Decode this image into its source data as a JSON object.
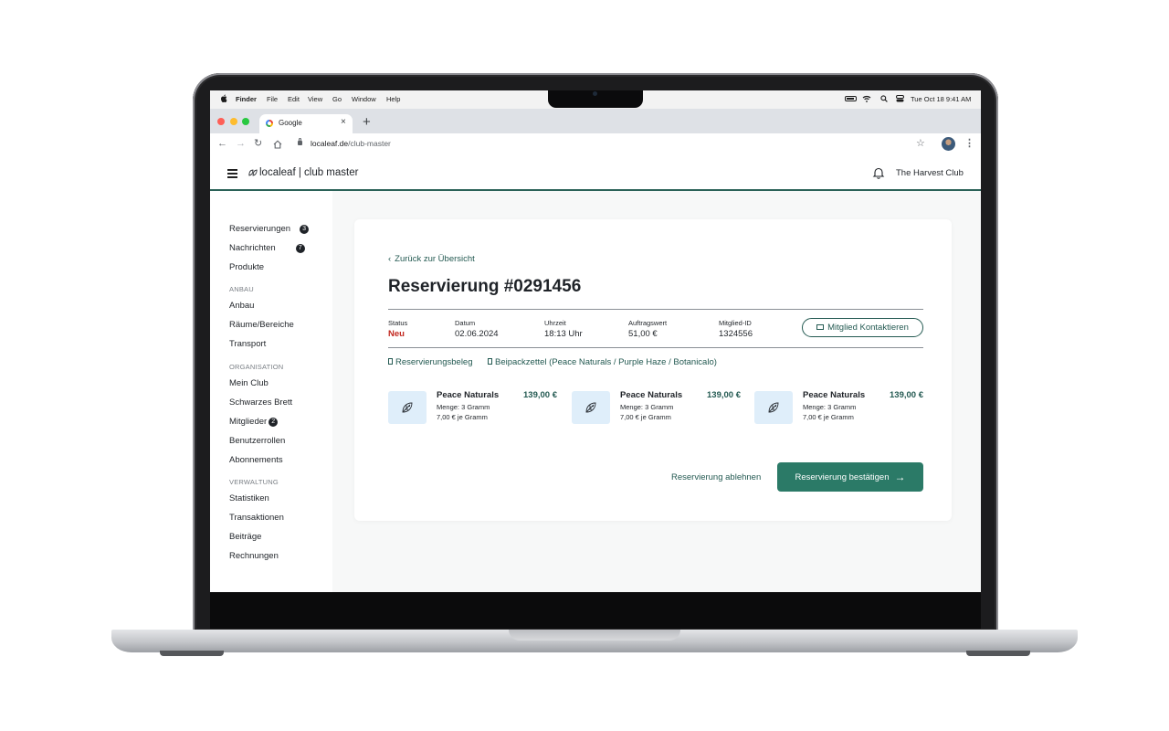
{
  "menubar": {
    "app": "Finder",
    "items": [
      "File",
      "Edit",
      "View",
      "Go",
      "Window",
      "Help"
    ],
    "clock": "Tue Oct 18  9:41 AM"
  },
  "browser": {
    "tab_title": "Google",
    "tab_close": "×",
    "new_tab": "+",
    "url_host": "localeaf.de",
    "url_path": "/club-master"
  },
  "header": {
    "brand": "localeaf | club master",
    "club_name": "The Harvest Club"
  },
  "sidebar": {
    "reservierungen": "Reservierungen",
    "reservierungen_count": "3",
    "nachrichten": "Nachrichten",
    "nachrichten_count": "7",
    "produkte": "Produkte",
    "section_anbau": "ANBAU",
    "anbau": "Anbau",
    "raeume": "Räume/Bereiche",
    "transport": "Transport",
    "section_organisation": "ORGANISATION",
    "mein_club": "Mein Club",
    "schwarzes_brett": "Schwarzes Brett",
    "mitglieder": "Mitglieder",
    "mitglieder_count": "2",
    "benutzerrollen": "Benutzerrollen",
    "abonnements": "Abonnements",
    "section_verwaltung": "VERWALTUNG",
    "statistiken": "Statistiken",
    "transaktionen": "Transaktionen",
    "beitraege": "Beiträge",
    "rechnungen": "Rechnungen"
  },
  "reservation": {
    "back": "Zurück zur Übersicht",
    "title": "Reservierung #0291456",
    "status_label": "Status",
    "status_value": "Neu",
    "date_label": "Datum",
    "date_value": "02.06.2024",
    "time_label": "Uhrzeit",
    "time_value": "18:13 Uhr",
    "amount_label": "Auftragswert",
    "amount_value": "51,00 €",
    "member_label": "Mitglied-ID",
    "member_value": "1324556",
    "contact_button": "Mitglied Kontaktieren",
    "doc_receipt": "Reservierungsbeleg",
    "doc_leaflet": "Beipackzettel (Peace Naturals / Purple Haze / Botanicalo)",
    "products": [
      {
        "name": "Peace Naturals",
        "price": "139,00 €",
        "qty": "Menge: 3 Gramm",
        "unit": "7,00 € je Gramm"
      },
      {
        "name": "Peace Naturals",
        "price": "139,00 €",
        "qty": "Menge: 3 Gramm",
        "unit": "7,00 € je Gramm"
      },
      {
        "name": "Peace Naturals",
        "price": "139,00 €",
        "qty": "Menge: 3 Gramm",
        "unit": "7,00 € je Gramm"
      }
    ],
    "decline": "Reservierung ablehnen",
    "confirm": "Reservierung bestätigen"
  },
  "colors": {
    "accent": "#245a52",
    "button": "#2b7a67",
    "status_new": "#c2271f",
    "thumb_bg": "#dfeefa"
  }
}
